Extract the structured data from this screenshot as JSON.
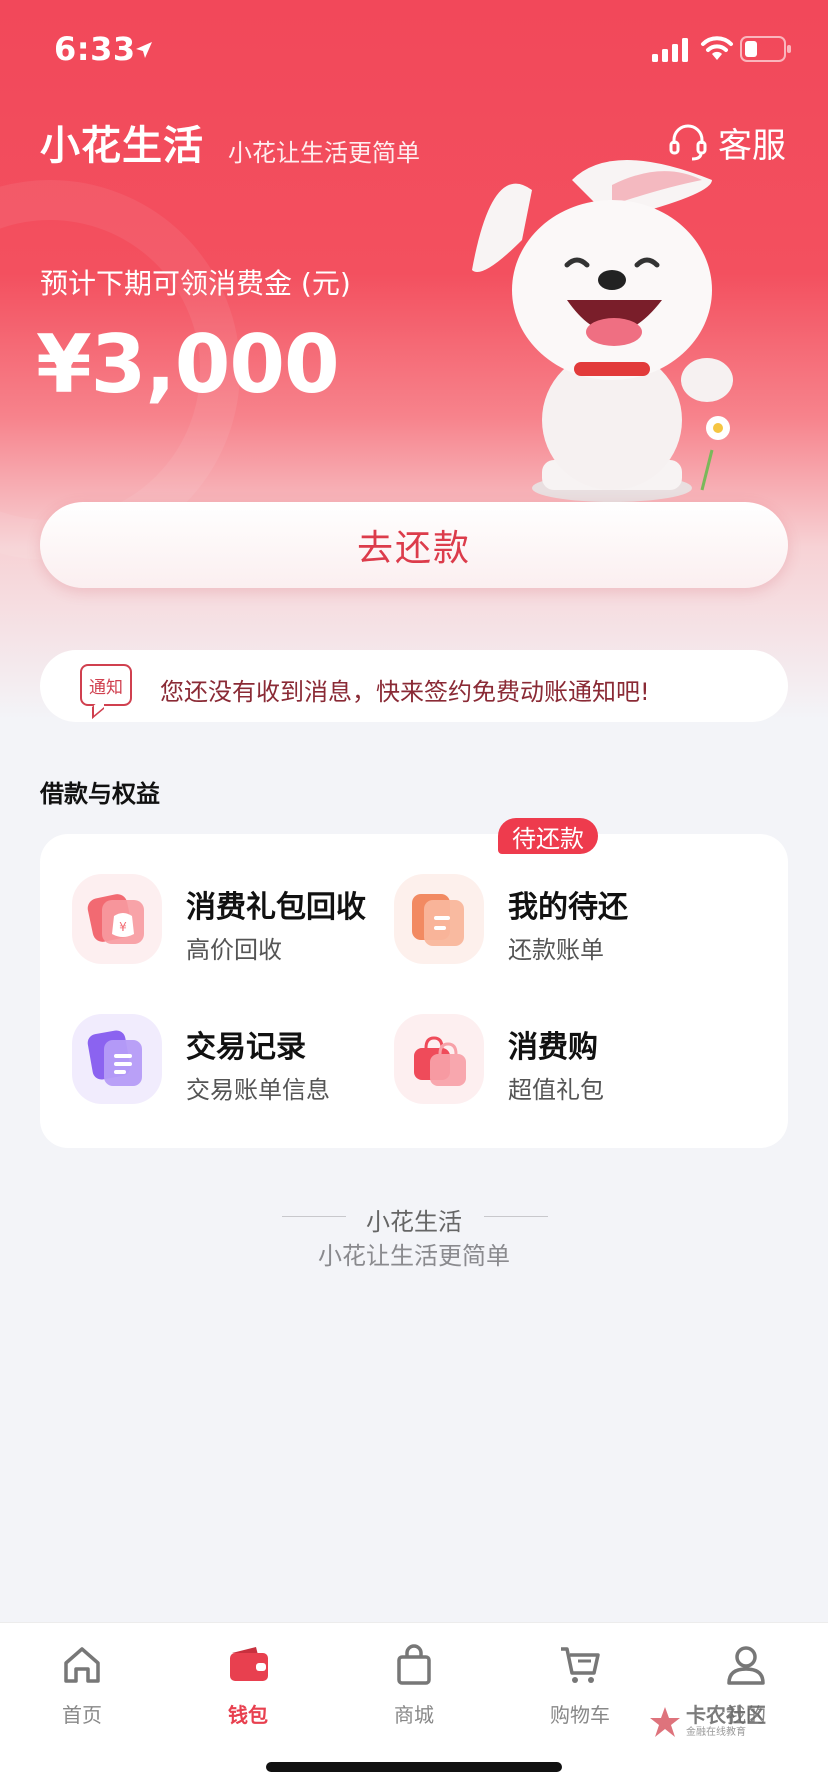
{
  "status_bar": {
    "time": "6:33"
  },
  "header": {
    "title": "小花生活",
    "slogan": "小花让生活更简单",
    "service_label": "客服"
  },
  "hero": {
    "amount_caption": "预计下期可领消费金 (元)",
    "amount_value": "¥3,000",
    "repay_button": "去还款"
  },
  "notice": {
    "badge": "通知",
    "text": "您还没有收到消息，快来签约免费动账通知吧!"
  },
  "benefits": {
    "section_title": "借款与权益",
    "items": [
      {
        "title": "消费礼包回收",
        "subtitle": "高价回收",
        "icon": "gift-bag-recycle-icon"
      },
      {
        "title": "我的待还",
        "subtitle": "还款账单",
        "icon": "bill-document-icon",
        "tag": "待还款"
      },
      {
        "title": "交易记录",
        "subtitle": "交易账单信息",
        "icon": "transaction-list-icon"
      },
      {
        "title": "消费购",
        "subtitle": "超值礼包",
        "icon": "shopping-bag-icon"
      }
    ]
  },
  "footer": {
    "brand": "小花生活",
    "slogan": "小花让生活更简单"
  },
  "tab_bar": {
    "items": [
      {
        "label": "首页",
        "icon": "home-icon"
      },
      {
        "label": "钱包",
        "icon": "wallet-icon",
        "active": true
      },
      {
        "label": "商城",
        "icon": "store-bag-icon"
      },
      {
        "label": "购物车",
        "icon": "cart-icon"
      },
      {
        "label": "我的",
        "icon": "profile-icon"
      }
    ]
  },
  "watermark": {
    "main": "卡农社区",
    "sub": "金融在线教育"
  },
  "colors": {
    "primary": "#f2485a",
    "accent_text": "#dc3c4b",
    "tab_active": "#e8404f",
    "background": "#f3f4f8"
  }
}
